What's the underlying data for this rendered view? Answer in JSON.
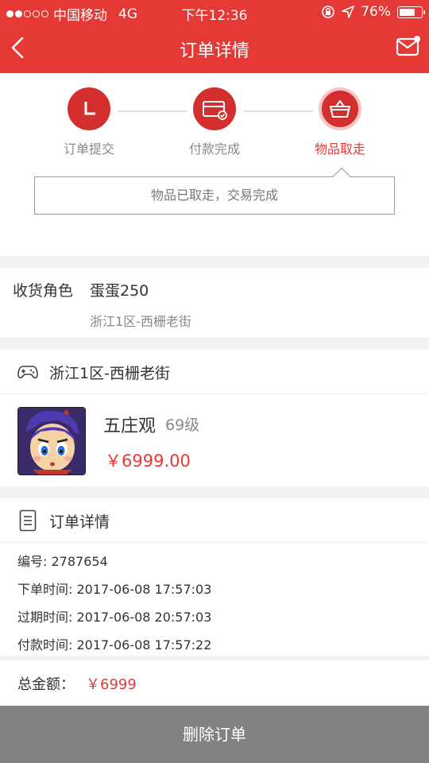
{
  "status_bar": {
    "carrier": "中国移动",
    "network": "4G",
    "time": "下午12:36",
    "battery": "76%",
    "battery_level": 0.76
  },
  "nav": {
    "title": "订单详情"
  },
  "progress": {
    "steps": [
      {
        "label": "订单提交",
        "icon": "clock-icon"
      },
      {
        "label": "付款完成",
        "icon": "card-icon"
      },
      {
        "label": "物品取走",
        "icon": "basket-icon",
        "active": true
      }
    ],
    "status_message": "物品已取走，交易完成"
  },
  "receiver": {
    "label": "收货角色",
    "name": "蛋蛋250",
    "server": "浙江1区-西栅老街"
  },
  "game": {
    "server_title": "浙江1区-西栅老街",
    "item_name": "五庄观",
    "item_level": "69级",
    "price": "￥6999.00"
  },
  "order_details": {
    "title": "订单详情",
    "rows": [
      "编号: 2787654",
      "下单时间: 2017-06-08 17:57:03",
      "过期时间: 2017-06-08 20:57:03",
      "付款时间: 2017-06-08 17:57:22"
    ]
  },
  "total": {
    "label": "总金额：",
    "amount": "￥6999"
  },
  "actions": {
    "delete_label": "删除订单"
  },
  "colors": {
    "accent": "#e53935",
    "button_gray": "#828282"
  }
}
